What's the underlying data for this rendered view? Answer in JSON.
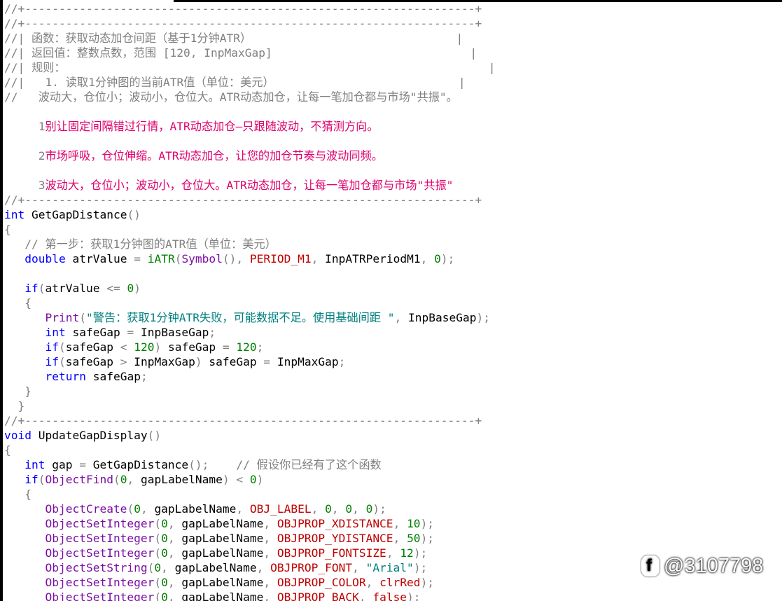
{
  "window": {
    "tab_active": true
  },
  "watermark": {
    "logo": "f-icon",
    "text": "@3107798"
  },
  "lines": [
    [
      [
        "cm",
        "//+------------------------------------------------------------------+"
      ]
    ],
    [
      [
        "cm",
        "//+------------------------------------------------------------------+"
      ]
    ],
    [
      [
        "cm",
        "//| 函数：获取动态加仓间距（基于1分钟ATR）                              |"
      ]
    ],
    [
      [
        "cm",
        "//| 返回值：整数点数，范围 [120, InpMaxGap]                             |"
      ]
    ],
    [
      [
        "cm",
        "//| 规则：                                                              |"
      ]
    ],
    [
      [
        "cm",
        "//|   1. 读取1分钟图的当前ATR值（单位：美元）                           |"
      ]
    ],
    [
      [
        "cm",
        "//   波动大，仓位小；波动小，仓位大。ATR动态加仓，让每一笔加仓都与市场\"共振\"。"
      ]
    ],
    [],
    [
      [
        "cm",
        "     1"
      ],
      [
        "ml",
        "别让固定间隔错过行情，ATR动态加仓—只跟随波动，不猜测方向。"
      ]
    ],
    [],
    [
      [
        "cm",
        "     2"
      ],
      [
        "ml",
        "市场呼吸，仓位伸缩。ATR动态加仓，让您的加仓节奏与波动同频。"
      ]
    ],
    [],
    [
      [
        "cm",
        "     3"
      ],
      [
        "ml",
        "波动大，仓位小；波动小，仓位大。ATR动态加仓，让每一笔加仓都与市场\"共振\""
      ]
    ],
    [
      [
        "cm",
        "//+------------------------------------------------------------------+"
      ]
    ],
    [
      [
        "kw",
        "int"
      ],
      [
        "var",
        " GetGapDistance"
      ],
      [
        "p",
        "()"
      ]
    ],
    [
      [
        "p",
        "{"
      ]
    ],
    [
      [
        "var",
        "   "
      ],
      [
        "cm",
        "// 第一步：获取1分钟图的ATR值（单位：美元）"
      ]
    ],
    [
      [
        "var",
        "   "
      ],
      [
        "kw",
        "double"
      ],
      [
        "var",
        " atrValue "
      ],
      [
        "p",
        "= "
      ],
      [
        "num",
        "iATR"
      ],
      [
        "p",
        "("
      ],
      [
        "fn",
        "Symbol"
      ],
      [
        "p",
        "(), "
      ],
      [
        "con",
        "PERIOD_M1"
      ],
      [
        "p",
        ", "
      ],
      [
        "var",
        "InpATRPeriodM1"
      ],
      [
        "p",
        ", "
      ],
      [
        "num",
        "0"
      ],
      [
        "p",
        ");"
      ]
    ],
    [],
    [
      [
        "var",
        "   "
      ],
      [
        "kw",
        "if"
      ],
      [
        "p",
        "("
      ],
      [
        "var",
        "atrValue "
      ],
      [
        "p",
        "<= "
      ],
      [
        "num",
        "0"
      ],
      [
        "p",
        ")"
      ]
    ],
    [
      [
        "var",
        "   "
      ],
      [
        "p",
        "{"
      ]
    ],
    [
      [
        "var",
        "      "
      ],
      [
        "fn",
        "Print"
      ],
      [
        "p",
        "("
      ],
      [
        "str",
        "\"警告：获取1分钟ATR失败，可能数据不足。使用基础间距 \""
      ],
      [
        "p",
        ", "
      ],
      [
        "var",
        "InpBaseGap"
      ],
      [
        "p",
        ");"
      ]
    ],
    [
      [
        "var",
        "      "
      ],
      [
        "kw",
        "int"
      ],
      [
        "var",
        " safeGap "
      ],
      [
        "p",
        "= "
      ],
      [
        "var",
        "InpBaseGap"
      ],
      [
        "p",
        ";"
      ]
    ],
    [
      [
        "var",
        "      "
      ],
      [
        "kw",
        "if"
      ],
      [
        "p",
        "("
      ],
      [
        "var",
        "safeGap "
      ],
      [
        "p",
        "< "
      ],
      [
        "num",
        "120"
      ],
      [
        "p",
        ") "
      ],
      [
        "var",
        "safeGap "
      ],
      [
        "p",
        "= "
      ],
      [
        "num",
        "120"
      ],
      [
        "p",
        ";"
      ]
    ],
    [
      [
        "var",
        "      "
      ],
      [
        "kw",
        "if"
      ],
      [
        "p",
        "("
      ],
      [
        "var",
        "safeGap "
      ],
      [
        "p",
        "> "
      ],
      [
        "var",
        "InpMaxGap"
      ],
      [
        "p",
        ") "
      ],
      [
        "var",
        "safeGap "
      ],
      [
        "p",
        "= "
      ],
      [
        "var",
        "InpMaxGap"
      ],
      [
        "p",
        ";"
      ]
    ],
    [
      [
        "var",
        "      "
      ],
      [
        "kw",
        "return"
      ],
      [
        "var",
        " safeGap"
      ],
      [
        "p",
        ";"
      ]
    ],
    [
      [
        "var",
        "   "
      ],
      [
        "p",
        "}"
      ]
    ],
    [
      [
        "var",
        "  "
      ],
      [
        "p",
        "}"
      ]
    ],
    [
      [
        "cm",
        "//+------------------------------------------------------------------+"
      ]
    ],
    [
      [
        "kw",
        "void"
      ],
      [
        "var",
        " UpdateGapDisplay"
      ],
      [
        "p",
        "()"
      ]
    ],
    [
      [
        "p",
        "{"
      ]
    ],
    [
      [
        "var",
        "   "
      ],
      [
        "kw",
        "int"
      ],
      [
        "var",
        " gap "
      ],
      [
        "p",
        "= "
      ],
      [
        "var",
        "GetGapDistance"
      ],
      [
        "p",
        "();"
      ],
      [
        "var",
        "    "
      ],
      [
        "cm",
        "// 假设你已经有了这个函数"
      ]
    ],
    [
      [
        "var",
        "   "
      ],
      [
        "kw",
        "if"
      ],
      [
        "p",
        "("
      ],
      [
        "fn",
        "ObjectFind"
      ],
      [
        "p",
        "("
      ],
      [
        "num",
        "0"
      ],
      [
        "p",
        ", "
      ],
      [
        "var",
        "gapLabelName"
      ],
      [
        "p",
        ") < "
      ],
      [
        "num",
        "0"
      ],
      [
        "p",
        ")"
      ]
    ],
    [
      [
        "var",
        "   "
      ],
      [
        "p",
        "{"
      ]
    ],
    [
      [
        "var",
        "      "
      ],
      [
        "fn",
        "ObjectCreate"
      ],
      [
        "p",
        "("
      ],
      [
        "num",
        "0"
      ],
      [
        "p",
        ", "
      ],
      [
        "var",
        "gapLabelName"
      ],
      [
        "p",
        ", "
      ],
      [
        "con",
        "OBJ_LABEL"
      ],
      [
        "p",
        ", "
      ],
      [
        "num",
        "0"
      ],
      [
        "p",
        ", "
      ],
      [
        "num",
        "0"
      ],
      [
        "p",
        ", "
      ],
      [
        "num",
        "0"
      ],
      [
        "p",
        ");"
      ]
    ],
    [
      [
        "var",
        "      "
      ],
      [
        "fn",
        "ObjectSetInteger"
      ],
      [
        "p",
        "("
      ],
      [
        "num",
        "0"
      ],
      [
        "p",
        ", "
      ],
      [
        "var",
        "gapLabelName"
      ],
      [
        "p",
        ", "
      ],
      [
        "con",
        "OBJPROP_XDISTANCE"
      ],
      [
        "p",
        ", "
      ],
      [
        "num",
        "10"
      ],
      [
        "p",
        ");"
      ]
    ],
    [
      [
        "var",
        "      "
      ],
      [
        "fn",
        "ObjectSetInteger"
      ],
      [
        "p",
        "("
      ],
      [
        "num",
        "0"
      ],
      [
        "p",
        ", "
      ],
      [
        "var",
        "gapLabelName"
      ],
      [
        "p",
        ", "
      ],
      [
        "con",
        "OBJPROP_YDISTANCE"
      ],
      [
        "p",
        ", "
      ],
      [
        "num",
        "50"
      ],
      [
        "p",
        ");"
      ]
    ],
    [
      [
        "var",
        "      "
      ],
      [
        "fn",
        "ObjectSetInteger"
      ],
      [
        "p",
        "("
      ],
      [
        "num",
        "0"
      ],
      [
        "p",
        ", "
      ],
      [
        "var",
        "gapLabelName"
      ],
      [
        "p",
        ", "
      ],
      [
        "con",
        "OBJPROP_FONTSIZE"
      ],
      [
        "p",
        ", "
      ],
      [
        "num",
        "12"
      ],
      [
        "p",
        ");"
      ]
    ],
    [
      [
        "var",
        "      "
      ],
      [
        "fn",
        "ObjectSetString"
      ],
      [
        "p",
        "("
      ],
      [
        "num",
        "0"
      ],
      [
        "p",
        ", "
      ],
      [
        "var",
        "gapLabelName"
      ],
      [
        "p",
        ", "
      ],
      [
        "con",
        "OBJPROP_FONT"
      ],
      [
        "p",
        ", "
      ],
      [
        "str",
        "\"Arial\""
      ],
      [
        "p",
        ");"
      ]
    ],
    [
      [
        "var",
        "      "
      ],
      [
        "fn",
        "ObjectSetInteger"
      ],
      [
        "p",
        "("
      ],
      [
        "num",
        "0"
      ],
      [
        "p",
        ", "
      ],
      [
        "var",
        "gapLabelName"
      ],
      [
        "p",
        ", "
      ],
      [
        "con",
        "OBJPROP_COLOR"
      ],
      [
        "p",
        ", "
      ],
      [
        "con",
        "clrRed"
      ],
      [
        "p",
        ");"
      ]
    ],
    [
      [
        "var",
        "      "
      ],
      [
        "fn",
        "ObjectSetInteger"
      ],
      [
        "p",
        "("
      ],
      [
        "num",
        "0"
      ],
      [
        "p",
        ", "
      ],
      [
        "var",
        "gapLabelName"
      ],
      [
        "p",
        ", "
      ],
      [
        "con",
        "OBJPROP_BACK"
      ],
      [
        "p",
        ", "
      ],
      [
        "con",
        "false"
      ],
      [
        "p",
        ");"
      ]
    ]
  ]
}
